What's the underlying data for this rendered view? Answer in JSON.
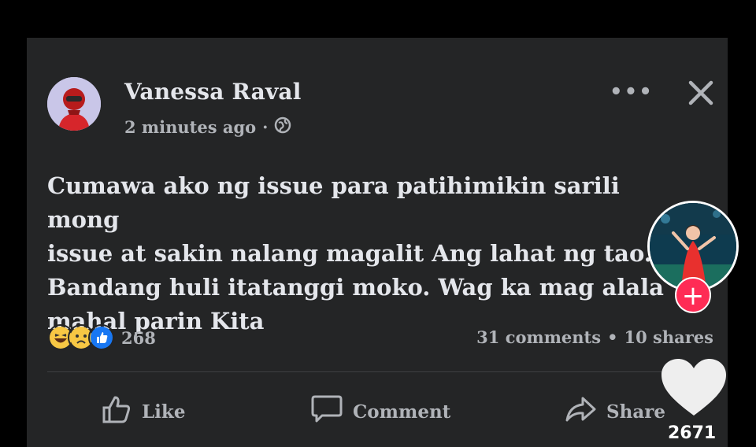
{
  "post": {
    "author": "Vanessa Raval",
    "time": "2 minutes ago",
    "separator": "·",
    "body_lines": [
      "Cumawa ako ng issue para patihimikin sarili mong",
      "issue at sakin nalang magalit Ang lahat ng tao.",
      "Bandang huli itatanggi moko. Wag ka mag alala",
      "mahal parin Kita"
    ],
    "reaction_count": "268",
    "reaction_icons": [
      "laugh-emoji",
      "sad-emoji",
      "like-thumb"
    ],
    "comments": "31 comments",
    "stats_separator": "•",
    "shares": "10 shares"
  },
  "actions": {
    "like": "Like",
    "comment": "Comment",
    "share": "Share"
  },
  "tiktok": {
    "like_count": "2671",
    "follow_symbol": "+"
  },
  "colors": {
    "card_bg": "#242526",
    "text": "#e4e6eb",
    "muted": "#b0b3b8",
    "follow_red": "#fe2c55",
    "like_blue": "#1877f2"
  }
}
